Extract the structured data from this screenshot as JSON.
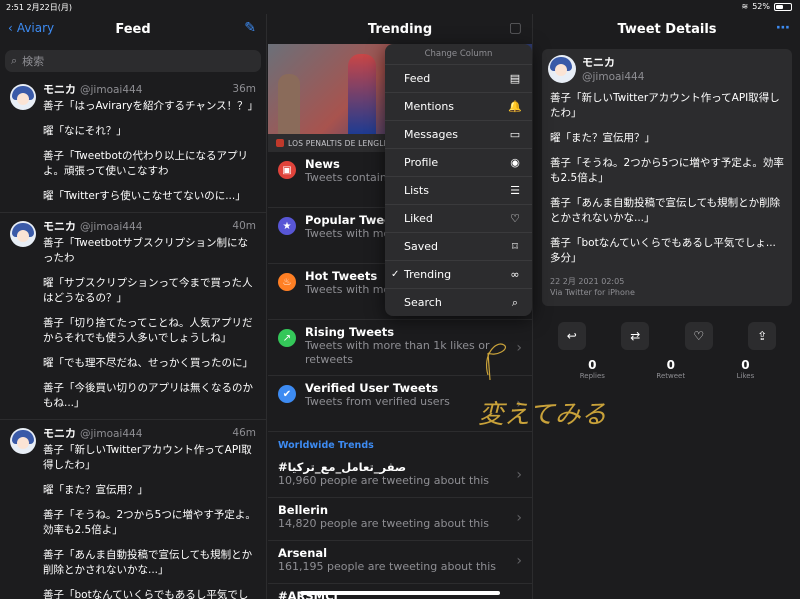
{
  "status_bar": {
    "time_date": "2:51 2月22日(月)",
    "battery": "52%",
    "battery_level": 0.52
  },
  "feed": {
    "back_label": "Aviary",
    "title": "Feed",
    "search_placeholder": "検索",
    "tweets": [
      {
        "name": "モニカ",
        "handle": "@jimoai444",
        "time": "36m",
        "lines": [
          "善子「はっAviraryを紹介するチャンス！？」",
          "曜「なにそれ？」",
          "善子「Tweetbotの代わり以上になるアプリよ。頑張って使いこなすわ",
          "曜「Twitterすら使いこなせてないのに...」"
        ]
      },
      {
        "name": "モニカ",
        "handle": "@jimoai444",
        "time": "40m",
        "lines": [
          "善子「Tweetbotサブスクリプション制になったわ",
          "曜「サブスクリプションって今まで買った人はどうなるの？」",
          "善子「切り捨てたってことね。人気アプリだからそれでも使う人多いでしょうしね」",
          "曜「でも理不尽だね、せっかく買ったのに」",
          "善子「今後買い切りのアプリは無くなるのかもね...」"
        ]
      },
      {
        "name": "モニカ",
        "handle": "@jimoai444",
        "time": "46m",
        "lines": [
          "善子「新しいTwitterアカウント作ってAPI取得したわ」",
          "曜「また？宣伝用？」",
          "善子「そうね。2つから5つに増やす予定よ。効率も2.5倍よ」",
          "善子「あんま自動投稿で宣伝しても規制とか削除とかされないかな...」",
          "善子「botなんていくらでもあるし平気でし"
        ]
      }
    ]
  },
  "trending": {
    "title": "Trending",
    "caption": "LOS PENALTIS DE LENGLET",
    "rows": [
      {
        "title": "News",
        "sub": "Tweets containin",
        "icon": "newspaper-icon",
        "color": "#e0433b"
      },
      {
        "title": "Popular Tweets",
        "sub": "Tweets with mor retweets",
        "icon": "star-icon",
        "color": "#5856d6"
      },
      {
        "title": "Hot Tweets",
        "sub": "Tweets with mor retweets",
        "icon": "flame-icon",
        "color": "#ff7f24"
      },
      {
        "title": "Rising Tweets",
        "sub": "Tweets with more than 1k likes or retweets",
        "icon": "arrow-up-icon",
        "color": "#34c759"
      },
      {
        "title": "Verified User Tweets",
        "sub": "Tweets from verified users",
        "icon": "verified-icon",
        "color": "#3d8bf2"
      }
    ],
    "worldwide_header": "Worldwide Trends",
    "worldwide": [
      {
        "title": "#صفر_تعامل_مع_تركيا",
        "sub": "10,960 people are tweeting about this"
      },
      {
        "title": "Bellerin",
        "sub": "14,820 people are tweeting about this"
      },
      {
        "title": "Arsenal",
        "sub": "161,195 people are tweeting about this"
      },
      {
        "title": "#ARSMCI",
        "sub": ""
      }
    ]
  },
  "change_column": {
    "header": "Change Column",
    "items": [
      {
        "label": "Feed",
        "icon": "feed-icon",
        "glyph": "▤",
        "checked": false
      },
      {
        "label": "Mentions",
        "icon": "bell-icon",
        "glyph": "🔔",
        "checked": false
      },
      {
        "label": "Messages",
        "icon": "message-icon",
        "glyph": "▭",
        "checked": false
      },
      {
        "label": "Profile",
        "icon": "profile-icon",
        "glyph": "◉",
        "checked": false
      },
      {
        "label": "Lists",
        "icon": "list-icon",
        "glyph": "☰",
        "checked": false
      },
      {
        "label": "Liked",
        "icon": "heart-icon",
        "glyph": "♡",
        "checked": false
      },
      {
        "label": "Saved",
        "icon": "bookmark-icon",
        "glyph": "⌑",
        "checked": false
      },
      {
        "label": "Trending",
        "icon": "binoculars-icon",
        "glyph": "∞",
        "checked": true
      },
      {
        "label": "Search",
        "icon": "search-icon",
        "glyph": "⌕",
        "checked": false
      }
    ],
    "check_mark": "✓"
  },
  "details": {
    "title": "Tweet Details",
    "name": "モニカ",
    "handle": "@jimoai444",
    "lines": [
      "善子「新しいTwitterアカウント作ってAPI取得したわ」",
      "曜「また？宣伝用？」",
      "善子「そうね。2つから5つに増やす予定よ。効率も2.5倍よ」",
      "善子「あんま自動投稿で宣伝しても規制とか削除とかされないかな...」",
      "善子「botなんていくらでもあるし平気でしょ...多分」"
    ],
    "timestamp": "22 2月 2021 02:05",
    "via": "Via Twitter for iPhone",
    "counts": [
      {
        "n": "0",
        "label": "Replies"
      },
      {
        "n": "0",
        "label": "Retweet"
      },
      {
        "n": "0",
        "label": "Likes"
      }
    ]
  },
  "handwriting_text": "変えてみる"
}
